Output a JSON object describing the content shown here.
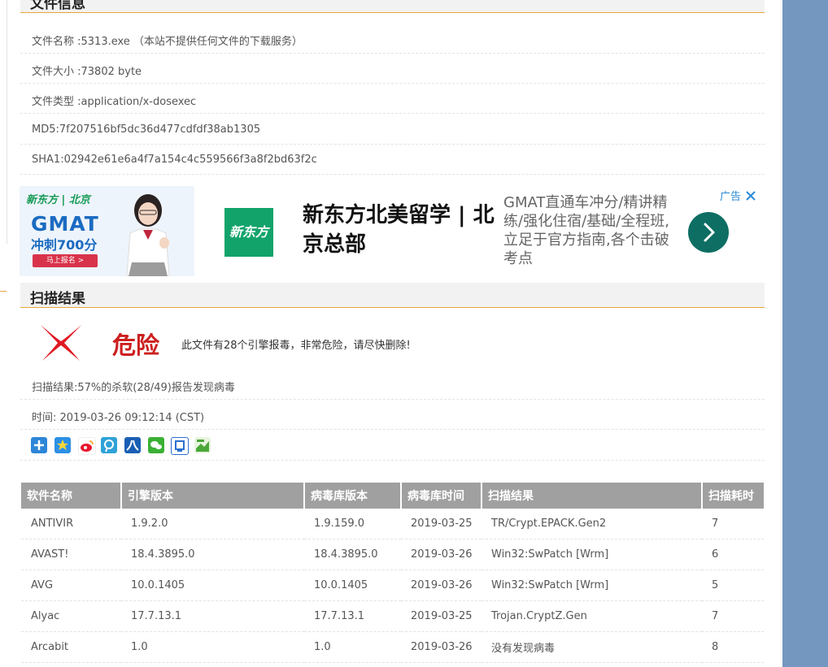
{
  "file_section": {
    "title": "文件信息",
    "name": "文件名称 :5313.exe （本站不提供任何文件的下载服务）",
    "size": "文件大小 :73802 byte",
    "type": "文件类型 :application/x-dosexec",
    "md5": "MD5:7f207516bf5dc36d477cdfdf38ab1305",
    "sha1": "SHA1:02942e61e6a4f7a154c4c559566f3a8f2bd63f2c"
  },
  "ad": {
    "brand": "新东方 | 北京",
    "banner_gmat": "GMAT",
    "banner_sprint": "冲刺700分",
    "banner_signup": "马上报名 >",
    "logo_text": "新东方",
    "title": "新东方北美留学 | 北京总部",
    "description": "GMAT直通车冲分/精讲精练/强化住宿/基础/全程班,立足于官方指南,各个击破考点",
    "tag": "广告",
    "close_icon": "close-icon",
    "colors": {
      "logo": "#12a36b",
      "arrow": "#0e6e63",
      "tag": "#2a8ad6"
    }
  },
  "scan_section": {
    "title": "扫描结果",
    "verdict": "危险",
    "verdict_message": "此文件有28个引擎报毒，非常危险，请尽快删除!",
    "summary": "扫描结果:57%的杀软(28/49)报告发现病毒",
    "time": "时间: 2019-03-26 09:12:14 (CST)",
    "danger_color": "#cc1f1f"
  },
  "share_icons": [
    "add-share-icon",
    "qzone-icon",
    "weibo-icon",
    "tencent-weibo-icon",
    "renren-icon",
    "wechat-icon",
    "tieba-icon",
    "sina-icon"
  ],
  "table": {
    "headers": [
      "软件名称",
      "引擎版本",
      "病毒库版本",
      "病毒库时间",
      "扫描结果",
      "扫描耗时"
    ],
    "rows": [
      {
        "name": "ANTIVIR",
        "engine": "1.9.2.0",
        "db": "1.9.159.0",
        "date": "2019-03-25",
        "result": "TR/Crypt.EPACK.Gen2",
        "time": "7",
        "status": "virus"
      },
      {
        "name": "AVAST!",
        "engine": "18.4.3895.0",
        "db": "18.4.3895.0",
        "date": "2019-03-26",
        "result": "Win32:SwPatch [Wrm]",
        "time": "6",
        "status": "virus"
      },
      {
        "name": "AVG",
        "engine": "10.0.1405",
        "db": "10.0.1405",
        "date": "2019-03-26",
        "result": "Win32:SwPatch [Wrm]",
        "time": "5",
        "status": "virus"
      },
      {
        "name": "Alyac",
        "engine": "17.7.13.1",
        "db": "17.7.13.1",
        "date": "2019-03-25",
        "result": "Trojan.CryptZ.Gen",
        "time": "7",
        "status": "virus"
      },
      {
        "name": "Arcabit",
        "engine": "1.0",
        "db": "1.0",
        "date": "2019-03-26",
        "result": "没有发现病毒",
        "time": "8",
        "status": "clean"
      }
    ]
  }
}
